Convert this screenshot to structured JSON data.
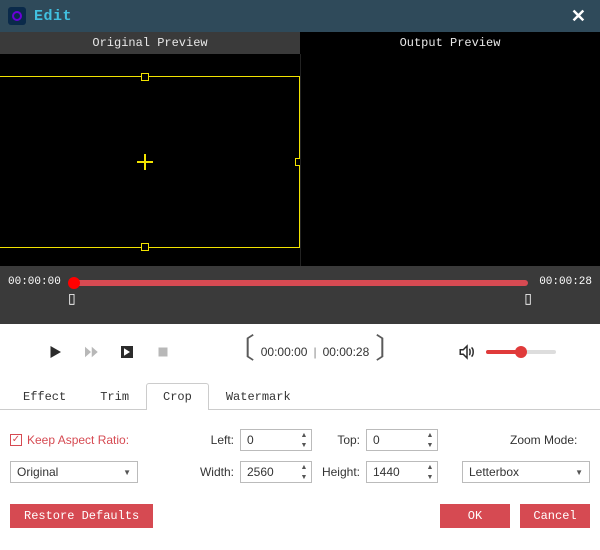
{
  "title": "Edit",
  "preview": {
    "left_label": "Original Preview",
    "right_label": "Output Preview"
  },
  "timeline": {
    "start": "00:00:00",
    "end": "00:00:28"
  },
  "playback": {
    "current": "00:00:00",
    "total": "00:00:28"
  },
  "tabs": {
    "effect": "Effect",
    "trim": "Trim",
    "crop": "Crop",
    "watermark": "Watermark"
  },
  "crop": {
    "keep_aspect_label": "Keep Aspect Ratio:",
    "left_label": "Left:",
    "left_value": "0",
    "top_label": "Top:",
    "top_value": "0",
    "width_label": "Width:",
    "width_value": "2560",
    "height_label": "Height:",
    "height_value": "1440",
    "zoom_mode_label": "Zoom Mode:",
    "aspect_select": "Original",
    "zoom_select": "Letterbox"
  },
  "footer": {
    "restore": "Restore Defaults",
    "ok": "OK",
    "cancel": "Cancel"
  }
}
